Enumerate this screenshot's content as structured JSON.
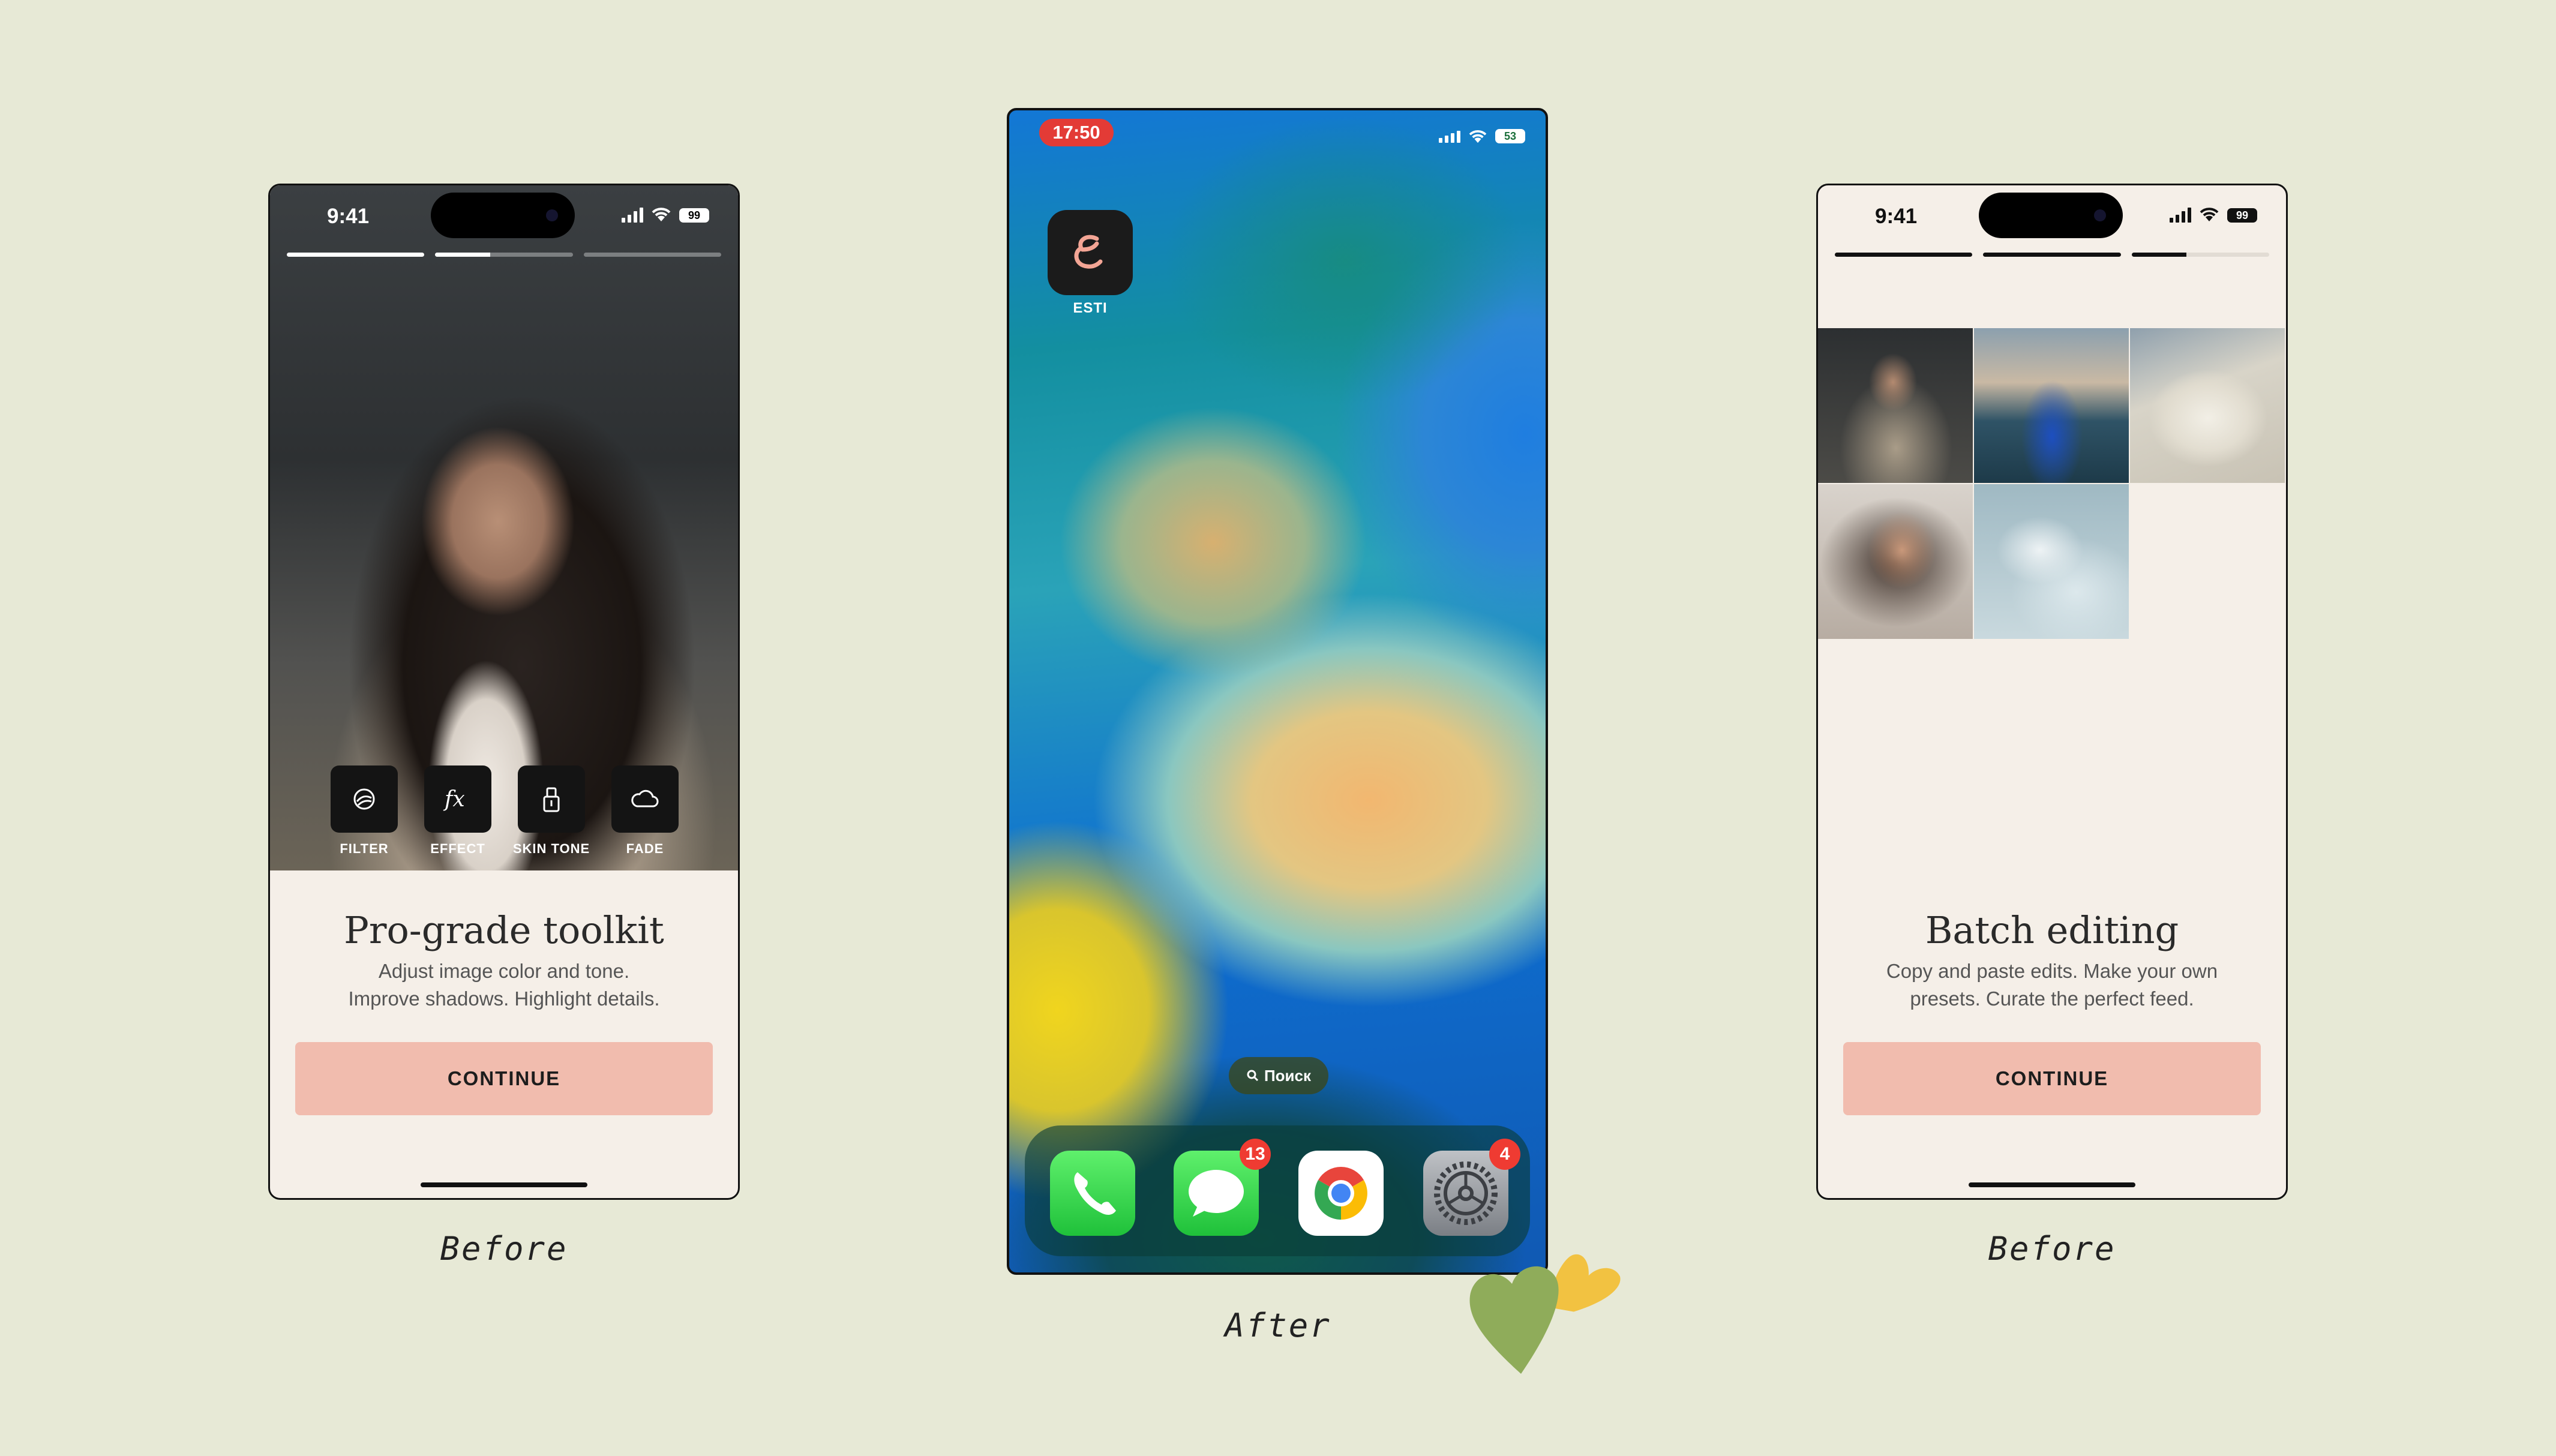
{
  "left": {
    "status": {
      "time": "9:41",
      "battery": "99"
    },
    "progress": [
      1,
      0.4,
      0
    ],
    "tools": [
      {
        "label": "FILTER",
        "icon": "filter-icon"
      },
      {
        "label": "EFFECT",
        "icon": "effect-fx-icon"
      },
      {
        "label": "SKIN TONE",
        "icon": "skin-tone-icon"
      },
      {
        "label": "FADE",
        "icon": "fade-cloud-icon"
      }
    ],
    "title": "Pro-grade toolkit",
    "subtitle_line1": "Adjust image color and tone.",
    "subtitle_line2": "Improve shadows. Highlight details.",
    "cta": "CONTINUE",
    "caption": "Before"
  },
  "middle": {
    "status": {
      "time": "17:50",
      "battery": "53"
    },
    "app": {
      "label": "ESTI",
      "icon": "esti-logo-icon"
    },
    "search": "Поиск",
    "dock": [
      {
        "name": "phone-app",
        "icon": "phone-icon",
        "badge": ""
      },
      {
        "name": "messages-app",
        "icon": "messages-icon",
        "badge": "13"
      },
      {
        "name": "chrome-app",
        "icon": "chrome-icon",
        "badge": ""
      },
      {
        "name": "settings-app",
        "icon": "settings-gear-icon",
        "badge": "4"
      }
    ],
    "caption": "After"
  },
  "right": {
    "status": {
      "time": "9:41",
      "battery": "99"
    },
    "progress": [
      1,
      1,
      0.4
    ],
    "grid_photos": [
      "photo-woman-trench-coat",
      "photo-woman-blue-dress-sea",
      "photo-white-knit-sweater",
      "photo-woman-selfie",
      "photo-hand-in-water"
    ],
    "title": "Batch editing",
    "subtitle_line1": "Copy and paste edits. Make your own",
    "subtitle_line2": "presets. Curate the perfect feed.",
    "cta": "CONTINUE",
    "caption": "Before"
  },
  "colors": {
    "background": "#e7e9d6",
    "cta": "#f1bcae",
    "card": "#f5efe8",
    "heart_green": "#8fac5a",
    "heart_yellow": "#f2c241",
    "badge": "#ef3b32"
  }
}
